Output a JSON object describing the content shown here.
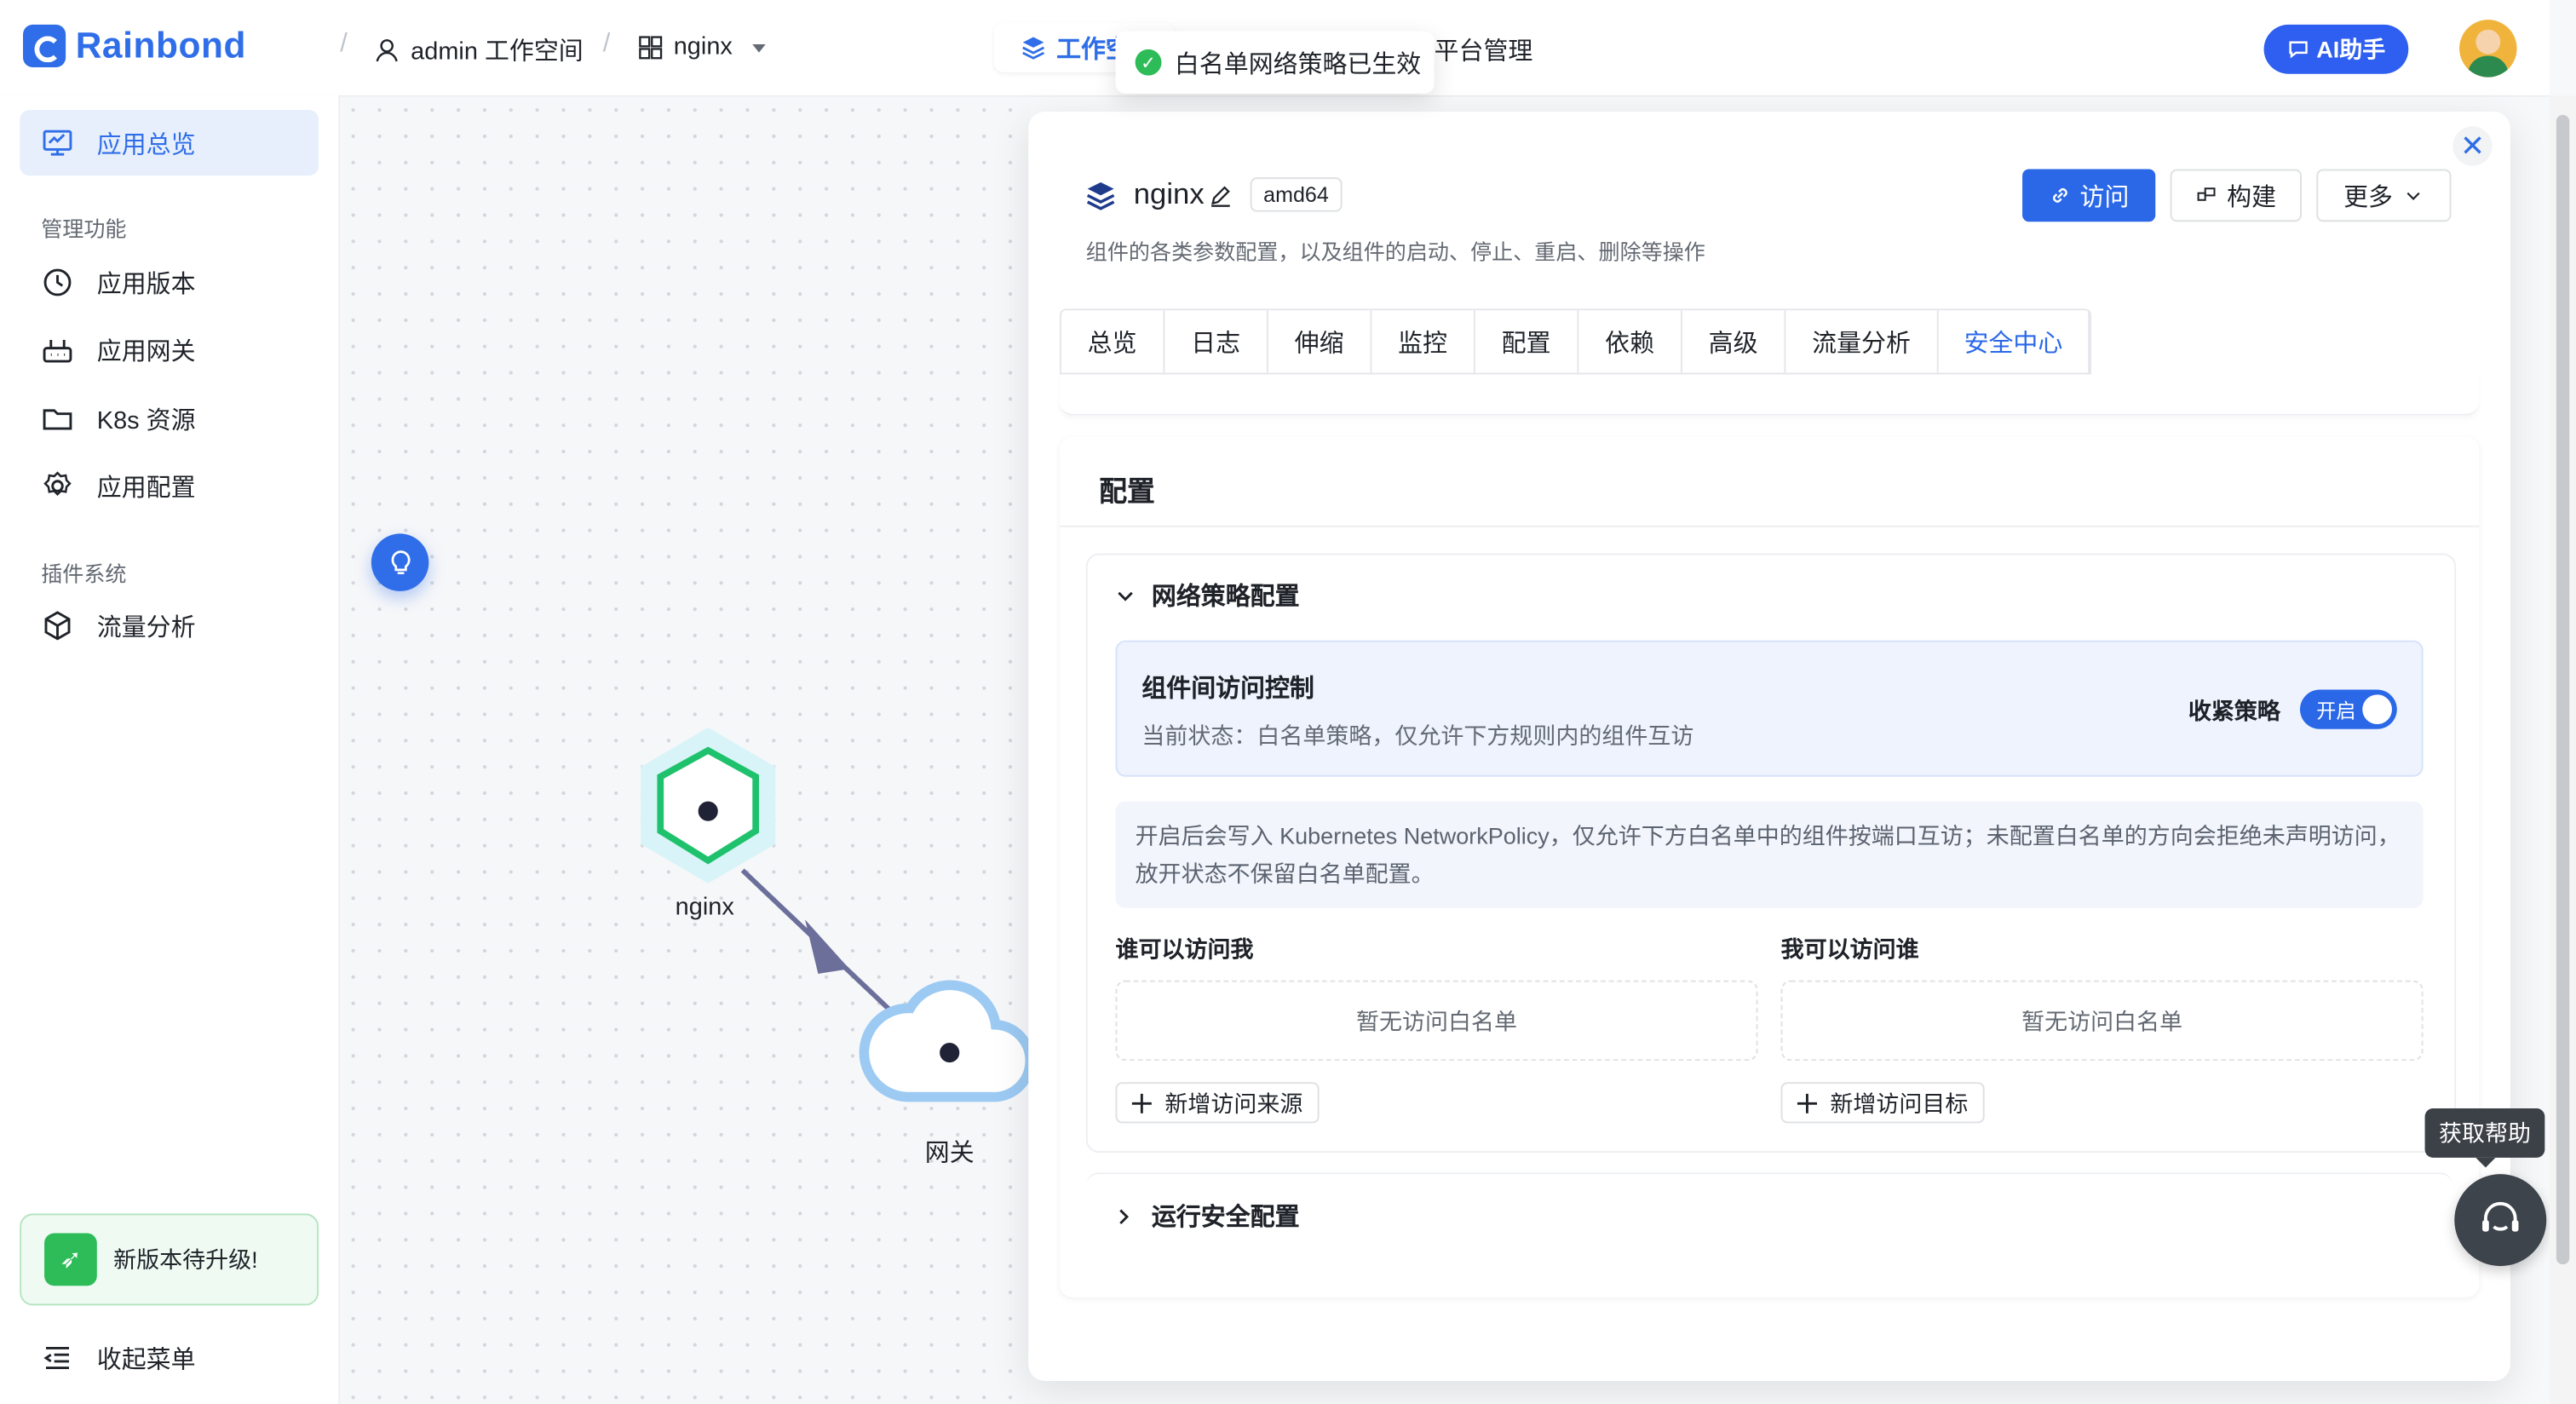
{
  "header": {
    "logo_text": "Rainbond",
    "workspace_crumb": "admin 工作空间",
    "app_crumb": "nginx",
    "workspace_tab": "工作空",
    "platform_tab": "平台管理",
    "ai_button": "AI助手",
    "toast_message": "白名单网络策略已生效"
  },
  "sidebar": {
    "overview": "应用总览",
    "section_manage": "管理功能",
    "items_manage": [
      "应用版本",
      "应用网关",
      "K8s 资源",
      "应用配置"
    ],
    "section_plugin": "插件系统",
    "items_plugin": [
      "流量分析"
    ],
    "upgrade_text": "新版本待升级!",
    "collapse_menu": "收起菜单"
  },
  "topology": {
    "nodes": [
      {
        "label": "nginx",
        "type": "component",
        "status_color": "#1fc26c"
      },
      {
        "label": "网关",
        "type": "gateway"
      }
    ]
  },
  "drawer": {
    "component_name": "nginx",
    "arch_tag": "amd64",
    "description": "组件的各类参数配置，以及组件的启动、停止、重启、删除等操作",
    "btn_visit": "访问",
    "btn_build": "构建",
    "btn_more": "更多",
    "tabs": [
      "总览",
      "日志",
      "伸缩",
      "监控",
      "配置",
      "依赖",
      "高级",
      "流量分析",
      "安全中心"
    ],
    "active_tab": "安全中心",
    "section_title": "配置",
    "network_policy": {
      "title": "网络策略配置",
      "control_title": "组件间访问控制",
      "control_status": "当前状态：白名单策略，仅允许下方规则内的组件互访",
      "strict_label": "收紧策略",
      "switch_text": "开启",
      "info": "开启后会写入 Kubernetes NetworkPolicy，仅允许下方白名单中的组件按端口互访；未配置白名单的方向会拒绝未声明访问，放开状态不保留白名单配置。",
      "who_can_access_me": "谁可以访问我",
      "who_i_can_access": "我可以访问谁",
      "empty_text": "暂无访问白名单",
      "add_source": "新增访问来源",
      "add_target": "新增访问目标"
    },
    "runtime_security": "运行安全配置"
  },
  "help": {
    "tooltip": "获取帮助"
  },
  "colors": {
    "brand": "#2f6ee8",
    "primary_button": "#2a68e8",
    "success": "#2dbc57"
  }
}
